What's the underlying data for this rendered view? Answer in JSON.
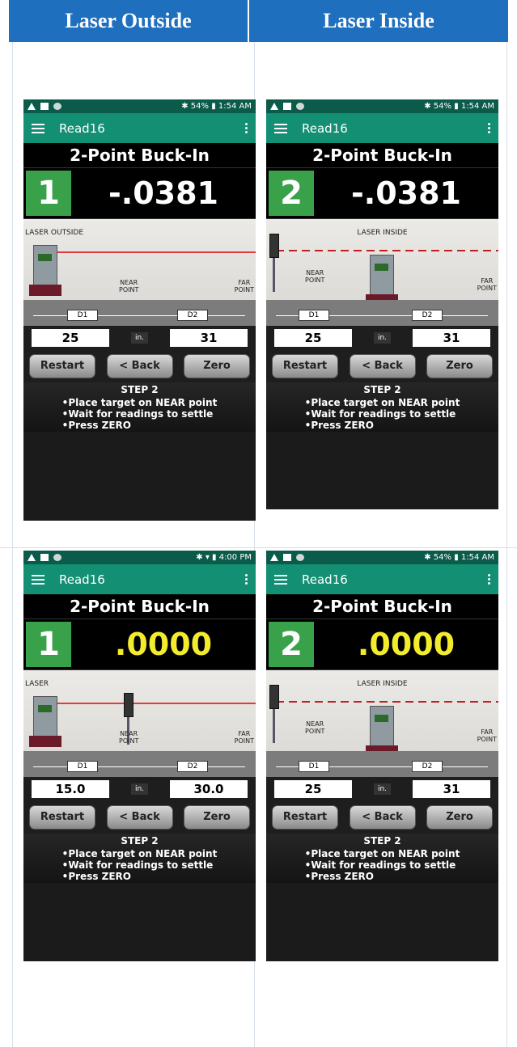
{
  "headers": {
    "left": "Laser Outside",
    "right": "Laser Inside"
  },
  "screens": [
    {
      "status_right": "✱ 54% ▮ 1:54 AM",
      "app_title": "Read16",
      "screen_title": "2-Point Buck-In",
      "step_number": "1",
      "reading": "-.0381",
      "reading_color": "#ffffff",
      "scene_label": "LASER OUTSIDE",
      "near_label": "NEAR\nPOINT",
      "far_label": "FAR\nPOINT",
      "d1": "D1",
      "d2": "D2",
      "near_value": "25",
      "unit": "in.",
      "far_value": "31",
      "buttons": {
        "restart": "Restart",
        "back": "< Back",
        "zero": "Zero"
      },
      "step_title": "STEP 2",
      "bullets": [
        "Place target on NEAR point",
        "Wait for readings to settle",
        "Press ZERO"
      ]
    },
    {
      "status_right": "✱ 54% ▮ 1:54 AM",
      "app_title": "Read16",
      "screen_title": "2-Point Buck-In",
      "step_number": "2",
      "reading": "-.0381",
      "reading_color": "#ffffff",
      "scene_label": "LASER INSIDE",
      "near_label": "NEAR\nPOINT",
      "far_label": "FAR\nPOINT",
      "d1": "D1",
      "d2": "D2",
      "near_value": "25",
      "unit": "in.",
      "far_value": "31",
      "buttons": {
        "restart": "Restart",
        "back": "< Back",
        "zero": "Zero"
      },
      "step_title": "STEP 2",
      "bullets": [
        "Place target on NEAR point",
        "Wait for readings to settle",
        "Press ZERO"
      ]
    },
    {
      "status_right": "✱ ▾ ▮ 4:00 PM",
      "app_title": "Read16",
      "screen_title": "2-Point Buck-In",
      "step_number": "1",
      "reading": ".0000",
      "reading_color": "#f3ec2c",
      "scene_label": "LASER",
      "near_label": "NEAR\nPOINT",
      "far_label": "FAR\nPOINT",
      "d1": "D1",
      "d2": "D2",
      "near_value": "15.0",
      "unit": "in.",
      "far_value": "30.0",
      "buttons": {
        "restart": "Restart",
        "back": "< Back",
        "zero": "Zero"
      },
      "step_title": "STEP 2",
      "bullets": [
        "Place target on NEAR point",
        "Wait for readings to settle",
        "Press ZERO"
      ]
    },
    {
      "status_right": "✱ 54% ▮ 1:54 AM",
      "app_title": "Read16",
      "screen_title": "2-Point Buck-In",
      "step_number": "2",
      "reading": ".0000",
      "reading_color": "#f3ec2c",
      "scene_label": "LASER INSIDE",
      "near_label": "NEAR\nPOINT",
      "far_label": "FAR\nPOINT",
      "d1": "D1",
      "d2": "D2",
      "near_value": "25",
      "unit": "in.",
      "far_value": "31",
      "buttons": {
        "restart": "Restart",
        "back": "< Back",
        "zero": "Zero"
      },
      "step_title": "STEP 2",
      "bullets": [
        "Place target on NEAR point",
        "Wait for readings to settle",
        "Press ZERO"
      ]
    }
  ]
}
